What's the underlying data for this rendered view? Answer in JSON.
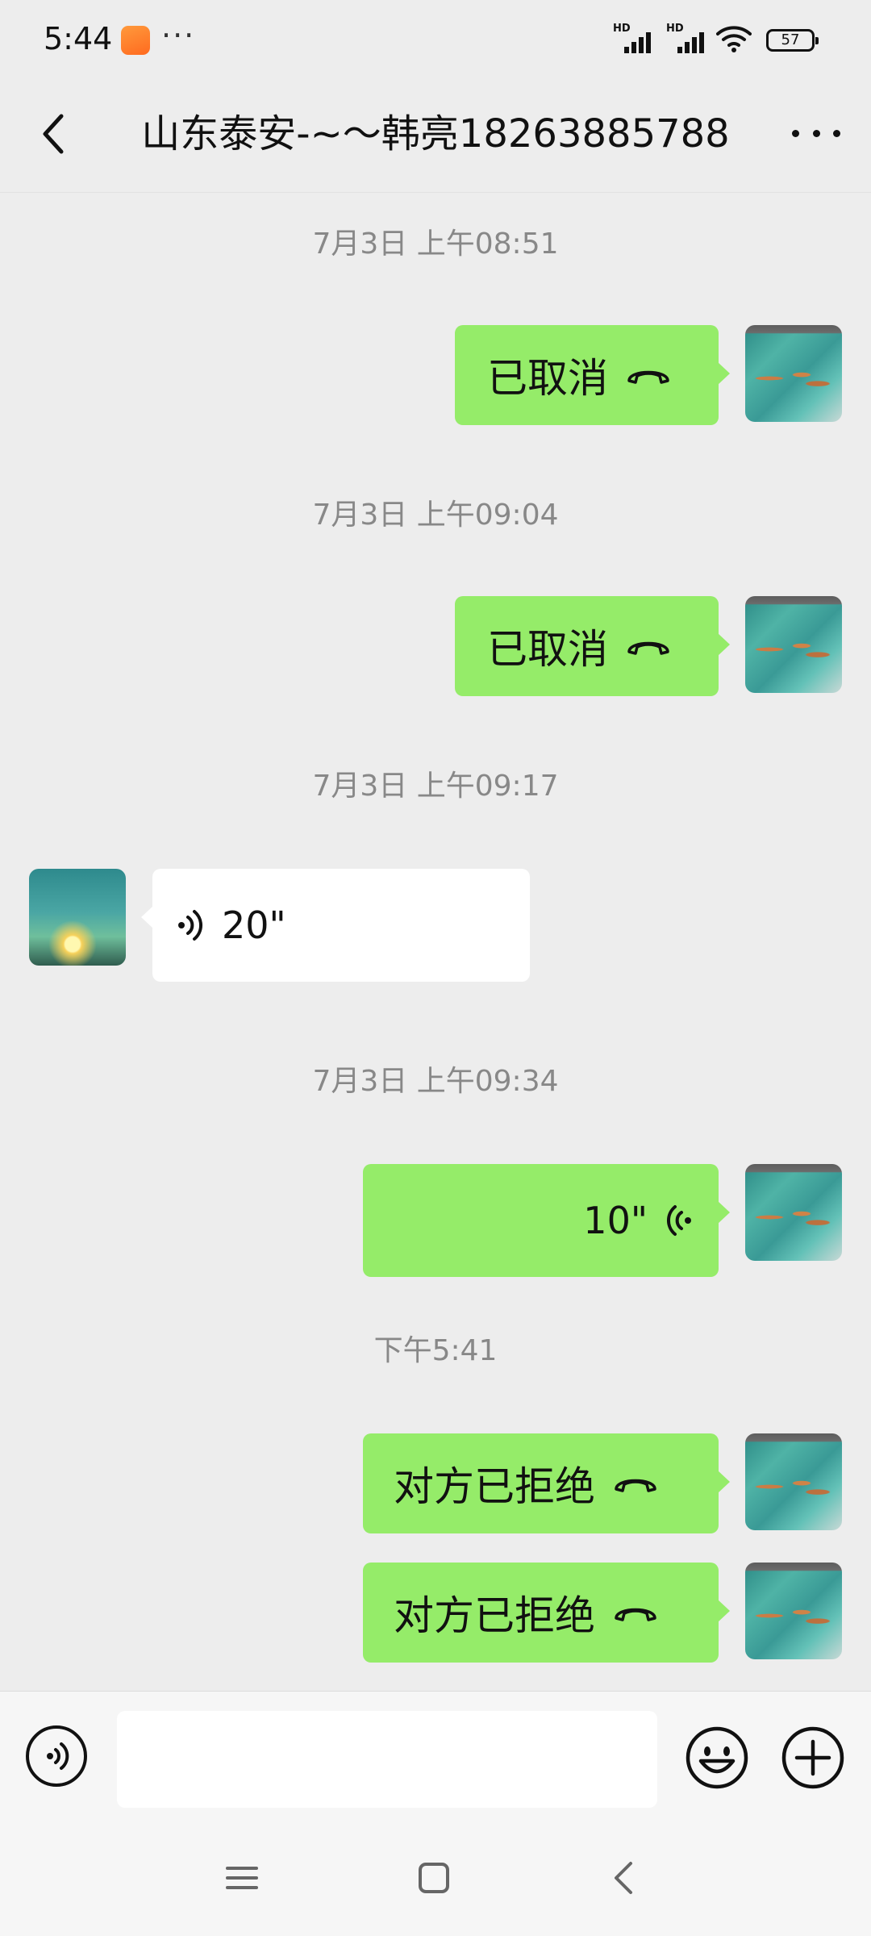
{
  "status_bar": {
    "time": "5:44",
    "more": "···",
    "signal_1_label": "HD",
    "signal_2_label": "HD",
    "battery": "57"
  },
  "header": {
    "title": "山东泰安-~～韩亮18263885788"
  },
  "messages": [
    {
      "type": "timestamp",
      "text": "7月3日 上午08:51"
    },
    {
      "type": "call",
      "direction": "outgoing",
      "text": "已取消"
    },
    {
      "type": "timestamp",
      "text": "7月3日 上午09:04"
    },
    {
      "type": "call",
      "direction": "outgoing",
      "text": "已取消"
    },
    {
      "type": "timestamp",
      "text": "7月3日 上午09:17"
    },
    {
      "type": "voice",
      "direction": "incoming",
      "duration": "20\""
    },
    {
      "type": "timestamp",
      "text": "7月3日 上午09:34"
    },
    {
      "type": "voice",
      "direction": "outgoing",
      "duration": "10\""
    },
    {
      "type": "timestamp",
      "text": "下午5:41"
    },
    {
      "type": "call",
      "direction": "outgoing",
      "text": "对方已拒绝"
    },
    {
      "type": "call",
      "direction": "outgoing",
      "text": "对方已拒绝"
    }
  ],
  "input_bar": {
    "message_value": ""
  },
  "colors": {
    "background": "#ededed",
    "outgoing_bubble": "#95ec69",
    "incoming_bubble": "#ffffff",
    "timestamp_text": "#888888"
  },
  "icons": {
    "back": "chevron-left-icon",
    "more": "more-horizontal-icon",
    "voice_input": "voice-input-icon",
    "emoji": "emoji-icon",
    "plus": "plus-icon",
    "call": "phone-hangup-icon",
    "nav_menu": "nav-menu-icon",
    "nav_home": "nav-home-icon",
    "nav_back": "nav-back-icon"
  }
}
